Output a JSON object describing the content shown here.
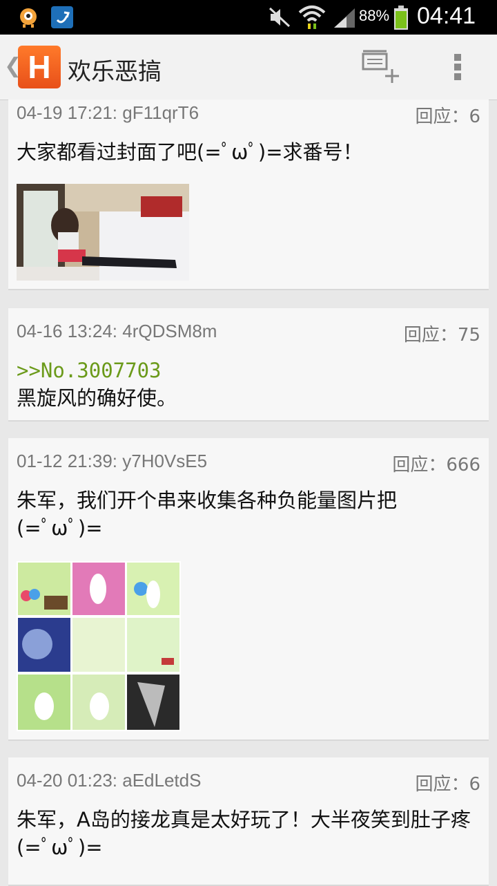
{
  "status_bar": {
    "battery_percent": "88%",
    "time": "04:41",
    "icons": [
      "app-notification-icon",
      "app-notification-icon-2",
      "mute-icon",
      "wifi-icon",
      "signal-icon",
      "battery-icon"
    ]
  },
  "action_bar": {
    "back_glyph": "❮",
    "logo_letter": "H",
    "title": "欢乐恶搞"
  },
  "posts": [
    {
      "meta": "04-19 17:21: gF11qrT6",
      "reply": "回应：6",
      "text": "大家都看过封面了吧(=ﾟωﾟ)=求番号！"
    },
    {
      "meta": "04-16 13:24: 4rQDSM8m",
      "reply": "回应：75",
      "quote": ">>No.3007703",
      "text": "黑旋风的确好使。"
    },
    {
      "meta": "01-12 21:39: y7H0VsE5",
      "reply": "回应：666",
      "text": "朱军，我们开个串来收集各种负能量图片把(=ﾟωﾟ)="
    },
    {
      "meta": "04-20 01:23: aEdLetdS",
      "reply": "回应：6",
      "text": "朱军，A岛的接龙真是太好玩了！大半夜笑到肚子疼(=ﾟωﾟ)="
    }
  ]
}
